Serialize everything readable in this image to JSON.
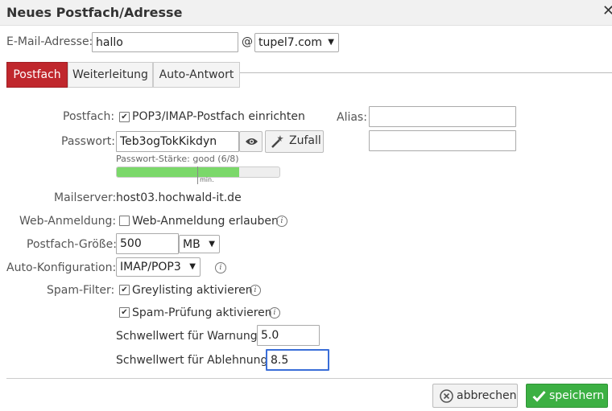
{
  "dialog": {
    "title": "Neues Postfach/Adresse",
    "close_symbol": "✕"
  },
  "email": {
    "label": "E-Mail-Adresse:",
    "local_value": "hallo",
    "at_symbol": "@",
    "domain_selected": "tupel7.com"
  },
  "tabs": [
    {
      "label": "Postfach",
      "active": true
    },
    {
      "label": "Weiterleitung",
      "active": false
    },
    {
      "label": "Auto-Antwort",
      "active": false
    }
  ],
  "postfach": {
    "label": "Postfach:",
    "checkbox_label": "POP3/IMAP-Postfach einrichten",
    "checked": true
  },
  "alias": {
    "label": "Alias:",
    "value1": "",
    "value2": ""
  },
  "password": {
    "label": "Passwort:",
    "value": "Teb3ogTokKikdyn",
    "random_label": "Zufall",
    "strength_text": "Passwort-Stärke: good (6/8)",
    "strength_fraction": 0.75,
    "min_marker_label": "min."
  },
  "mailserver": {
    "label": "Mailserver:",
    "value": "host03.hochwald-it.de"
  },
  "web_login": {
    "label": "Web-Anmeldung:",
    "checkbox_label": "Web-Anmeldung erlauben",
    "checked": false
  },
  "mailbox_size": {
    "label": "Postfach-Größe:",
    "value": "500",
    "unit_selected": "MB"
  },
  "auto_config": {
    "label": "Auto-Konfiguration:",
    "selected": "IMAP/POP3"
  },
  "spam_filter": {
    "label": "Spam-Filter:",
    "greylisting_label": "Greylisting aktivieren",
    "greylisting_checked": true,
    "spam_check_label": "Spam-Prüfung aktivieren",
    "spam_check_checked": true,
    "warn_label": "Schwellwert für Warnung:",
    "warn_value": "5.0",
    "reject_label": "Schwellwert für Ablehnung:",
    "reject_value": "8.5"
  },
  "footer": {
    "cancel_label": "abbrechen",
    "save_label": "speichern"
  },
  "colors": {
    "active_tab": "#c0272d",
    "save_button": "#3cb043",
    "strength_bar": "#7bd86a",
    "focus_border": "#3a6ed8"
  }
}
